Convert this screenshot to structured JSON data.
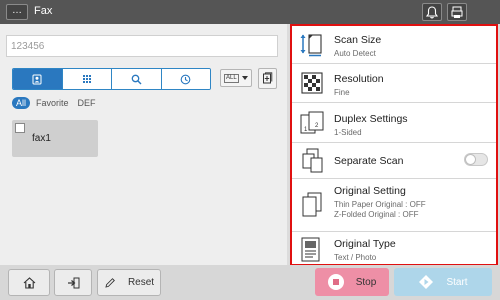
{
  "header": {
    "title": "Fax",
    "menu_label": "…"
  },
  "left": {
    "fax_number_value": "123456",
    "tabs": [
      "registration-tab",
      "keypad-tab",
      "search-tab",
      "history-tab"
    ],
    "index_dropdown": {
      "chip": "ALL"
    },
    "filters": [
      "All",
      "Favorite",
      "DEF"
    ],
    "addresses": [
      {
        "name": "fax1"
      }
    ]
  },
  "settings": {
    "scan_size": {
      "title": "Scan Size",
      "value": "Auto Detect"
    },
    "resolution": {
      "title": "Resolution",
      "value": "Fine"
    },
    "duplex": {
      "title": "Duplex Settings",
      "value": "1-Sided"
    },
    "separate_scan": {
      "title": "Separate Scan",
      "state": "off"
    },
    "original_setting": {
      "title": "Original  Setting",
      "line1": "Thin Paper Original : OFF",
      "line2": "Z-Folded Original : OFF"
    },
    "original_type": {
      "title": "Original Type",
      "value": "Text / Photo"
    }
  },
  "footer": {
    "reset_label": "Reset",
    "stop_label": "Stop",
    "start_label": "Start"
  },
  "colors": {
    "accent": "#2a78bf",
    "highlight_border": "#e01010",
    "stop": "#ee8fa6",
    "start": "#aed6ea"
  }
}
